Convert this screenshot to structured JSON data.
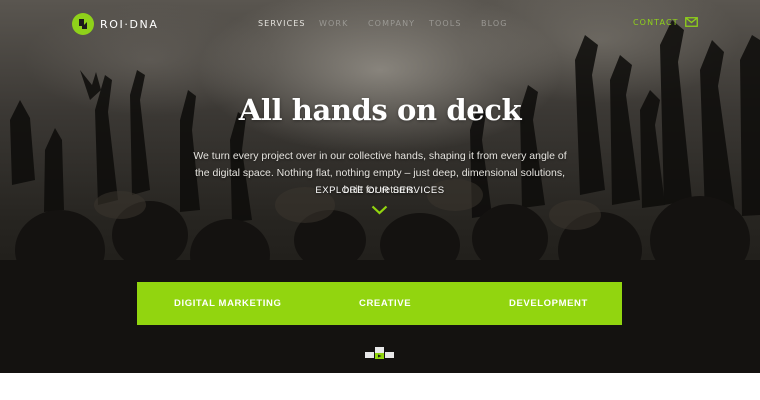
{
  "brand": {
    "name": "ROI·DNA"
  },
  "nav": {
    "items": [
      {
        "label": "SERVICES",
        "active": true
      },
      {
        "label": "WORK",
        "active": false
      },
      {
        "label": "COMPANY",
        "active": false
      },
      {
        "label": "TOOLS",
        "active": false
      },
      {
        "label": "BLOG",
        "active": false
      }
    ],
    "contact": {
      "label": "CONTACT",
      "icon": "mail-icon"
    }
  },
  "hero": {
    "headline": "All hands on deck",
    "lede": "We turn every project over in our collective hands, shaping it from every angle of the digital space. Nothing flat, nothing empty – just deep, dimensional solutions, built for returns.",
    "cta_label": "EXPLORE OUR SERVICES",
    "cta_icon": "chevron-down-icon"
  },
  "services": {
    "items": [
      {
        "label": "DIGITAL MARKETING"
      },
      {
        "label": "CREATIVE"
      },
      {
        "label": "DEVELOPMENT"
      }
    ]
  },
  "colors": {
    "accent": "#92d50f",
    "text_light": "#ffffff",
    "nav_inactive": "#9a9893"
  }
}
